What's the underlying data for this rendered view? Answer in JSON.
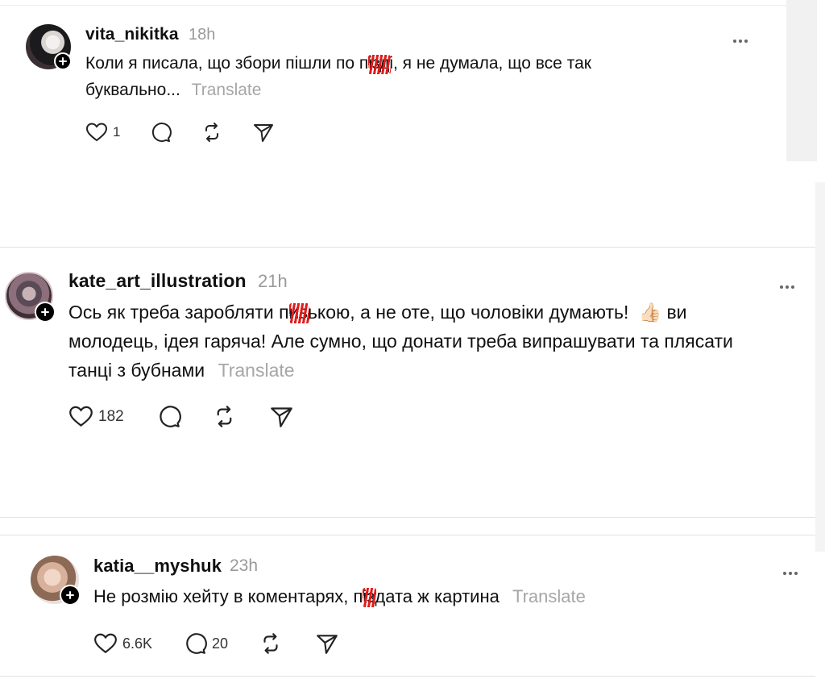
{
  "posts": [
    {
      "username": "vita_nikitka",
      "time": "18h",
      "text_line1_a": "Коли я писала, що збори пішли по п",
      "text_line1_censored": "iзд",
      "text_line1_b": "і, я не думала, що все так",
      "text_line2": "буквально...",
      "translate": "Translate",
      "likes": "1",
      "comments": ""
    },
    {
      "username": "kate_art_illustration",
      "time": "21h",
      "text_line1_a": "Ось як треба заробляти п",
      "text_line1_censored": "из",
      "text_line1_b": "ькою, а не оте, що чоловіки думають!",
      "emoji": "👍🏻",
      "text_line1_c": "ви",
      "text_line2": "молодець, ідея гаряча! Але сумно, що донати треба випрашувати та плясати",
      "text_line3": "танці з бубнами",
      "translate": "Translate",
      "likes": "182",
      "comments": ""
    },
    {
      "username": "katia__myshuk",
      "time": "23h",
      "text_line1_a": "Не розмію хейту в коментарях, п",
      "text_line1_censored": "iз",
      "text_line1_b": "дата ж картина",
      "translate": "Translate",
      "likes": "6.6K",
      "comments": "20"
    }
  ],
  "icons": [
    "heart-icon",
    "comment-icon",
    "repost-icon",
    "share-icon",
    "more-icon",
    "follow-plus-icon"
  ],
  "colors": {
    "censor": "#e21b1b",
    "muted": "#9a9a9a",
    "text": "#101010"
  }
}
